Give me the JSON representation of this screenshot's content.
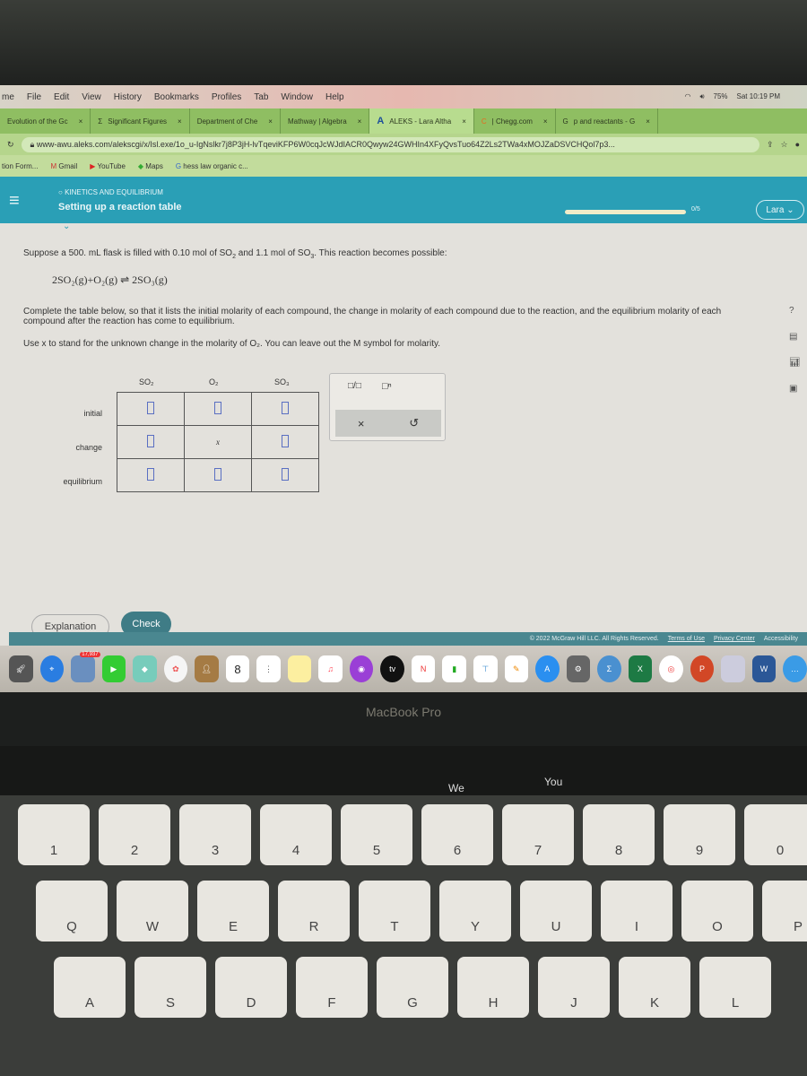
{
  "menubar": {
    "app": "me",
    "items": [
      "File",
      "Edit",
      "View",
      "History",
      "Bookmarks",
      "Profiles",
      "Tab",
      "Window",
      "Help"
    ],
    "battery": "75%",
    "clock": "Sat 10:19 PM"
  },
  "tabs": [
    {
      "label": "Evolution of the Gc"
    },
    {
      "label": "Significant Figures"
    },
    {
      "label": "Department of Che"
    },
    {
      "label": "Mathway | Algebra"
    },
    {
      "label": "ALEKS - Lara Altha",
      "active": true
    },
    {
      "label": "| Chegg.com"
    },
    {
      "label": "p and reactants - G"
    }
  ],
  "url": "www-awu.aleks.com/alekscgi/x/Isl.exe/1o_u-IgNslkr7j8P3jH-lvTqeviKFP6W0cqJcWJdIACR0Qwyw24GWHIn4XFyQvsTuo64Z2Ls2TWa4xMOJZaDSVCHQol7p3...",
  "bookmarks": [
    "tion Form...",
    "Gmail",
    "YouTube",
    "Maps",
    "hess law organic c..."
  ],
  "header": {
    "topic": "KINETICS AND EQUILIBRIUM",
    "title": "Setting up a reaction table",
    "progress_label": "0/5",
    "progress": 0,
    "user": "Lara"
  },
  "question": {
    "intro_a": "Suppose a 500. mL flask is filled with 0.10 mol of SO",
    "intro_b": " and 1.1 mol of SO",
    "intro_c": ". This reaction becomes possible:",
    "equation": "2SO₂(g)+O₂(g) ⇌ 2SO₃(g)",
    "instructions": "Complete the table below, so that it lists the initial molarity of each compound, the change in molarity of each compound due to the reaction, and the equilibrium molarity of each compound after the reaction has come to equilibrium.",
    "hint": "Use x to stand for the unknown change in the molarity of O₂. You can leave out the M symbol for molarity."
  },
  "table": {
    "columns": [
      "SO₂",
      "O₂",
      "SO₃"
    ],
    "rows": [
      "initial",
      "change",
      "equilibrium"
    ],
    "change_o2": "x"
  },
  "palette": {
    "fraction": "□/□",
    "superscript": "□ⁿ",
    "clear": "×",
    "undo": "↺"
  },
  "footer": {
    "explanation": "Explanation",
    "check": "Check",
    "copyright": "© 2022 McGraw Hill LLC. All Rights Reserved.",
    "terms": "Terms of Use",
    "privacy": "Privacy Center",
    "accessibility": "Accessibility"
  },
  "dock": {
    "calendar_day": "8",
    "mail_badge": "17,937"
  },
  "laptop": {
    "brand": "MacBook Pro",
    "touchbar": [
      "We",
      "You"
    ]
  },
  "keyboard": {
    "numbers": [
      "1",
      "2",
      "3",
      "4",
      "5",
      "6",
      "7",
      "8",
      "9",
      "0"
    ],
    "top": [
      "Q",
      "W",
      "E",
      "R",
      "T",
      "Y",
      "U",
      "I",
      "O",
      "P"
    ],
    "home": [
      "A",
      "S",
      "D",
      "F",
      "G",
      "H",
      "J",
      "K",
      "L"
    ]
  }
}
